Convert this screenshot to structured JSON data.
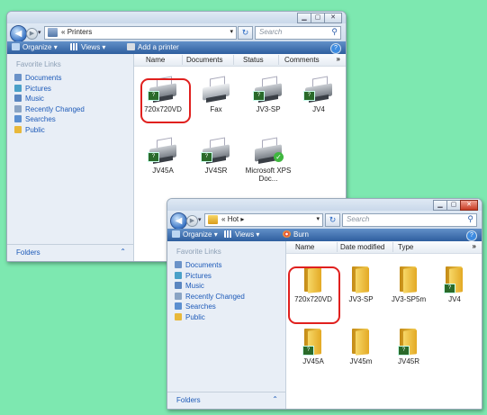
{
  "colors": {
    "background": "#7de8b0",
    "highlight": "#e0201e",
    "toolbar": "#2e5e9e",
    "link": "#1d5ab8"
  },
  "window_back": {
    "caption_buttons": [
      "minimize-icon",
      "maximize-icon",
      "close-icon"
    ],
    "address": {
      "prefix": "«",
      "path": "Printers"
    },
    "search_placeholder": "Search",
    "toolbar": {
      "organize": "Organize",
      "views": "Views",
      "action": "Add a printer"
    },
    "favorite_links_title": "Favorite Links",
    "favorite_links": [
      "Documents",
      "Pictures",
      "Music",
      "Recently Changed",
      "Searches",
      "Public"
    ],
    "folders_label": "Folders",
    "columns": [
      "Name",
      "Documents",
      "Status",
      "Comments"
    ],
    "more_columns": "»",
    "items": [
      {
        "label": "720x720VD",
        "badge": "?"
      },
      {
        "label": "Fax",
        "badge": ""
      },
      {
        "label": "JV3-SP",
        "badge": "?"
      },
      {
        "label": "JV4",
        "badge": "?"
      },
      {
        "label": "JV45A",
        "badge": "?"
      },
      {
        "label": "JV4SR",
        "badge": "?"
      },
      {
        "label": "Microsoft XPS Doc...",
        "badge": "✓"
      }
    ]
  },
  "window_front": {
    "caption_buttons": [
      "minimize-icon",
      "maximize-icon",
      "close-icon"
    ],
    "address": {
      "prefix": "«",
      "path": "Hot",
      "arrow": "▸"
    },
    "search_placeholder": "Search",
    "toolbar": {
      "organize": "Organize",
      "views": "Views",
      "action": "Burn"
    },
    "favorite_links_title": "Favorite Links",
    "favorite_links": [
      "Documents",
      "Pictures",
      "Music",
      "Recently Changed",
      "Searches",
      "Public"
    ],
    "folders_label": "Folders",
    "columns": [
      "Name",
      "Date modified",
      "Type"
    ],
    "more_columns": "»",
    "items": [
      {
        "label": "720x720VD",
        "badge": ""
      },
      {
        "label": "JV3-SP",
        "badge": ""
      },
      {
        "label": "JV3-SP5m",
        "badge": ""
      },
      {
        "label": "JV4",
        "badge": "?"
      },
      {
        "label": "JV45A",
        "badge": "?"
      },
      {
        "label": "JV45m",
        "badge": ""
      },
      {
        "label": "JV45R",
        "badge": "?"
      }
    ]
  }
}
